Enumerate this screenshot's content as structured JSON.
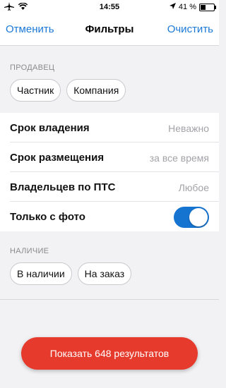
{
  "status": {
    "time": "14:55",
    "battery": "41 %",
    "battery_level": 0.41,
    "icons": [
      "airplane-icon",
      "wifi-icon",
      "location-arrow-icon",
      "battery-icon"
    ]
  },
  "nav": {
    "cancel_label": "Отменить",
    "title": "Фильтры",
    "clear_label": "Очистить"
  },
  "seller": {
    "title": "ПРОДАВЕЦ",
    "options": [
      "Частник",
      "Компания"
    ]
  },
  "rows": [
    {
      "label": "Срок владения",
      "value": "Неважно"
    },
    {
      "label": "Срок размещения",
      "value": "за все время"
    },
    {
      "label": "Владельцев по ПТС",
      "value": "Любое"
    },
    {
      "label": "Только с фото",
      "toggle_on": true
    }
  ],
  "availability": {
    "title": "НАЛИЧИЕ",
    "options": [
      "В наличии",
      "На заказ"
    ]
  },
  "cta_label": "Показать 648 результатов",
  "colors": {
    "accent": "#1b78d6",
    "toggle": "#1674d1",
    "cta": "#e53a2c"
  }
}
